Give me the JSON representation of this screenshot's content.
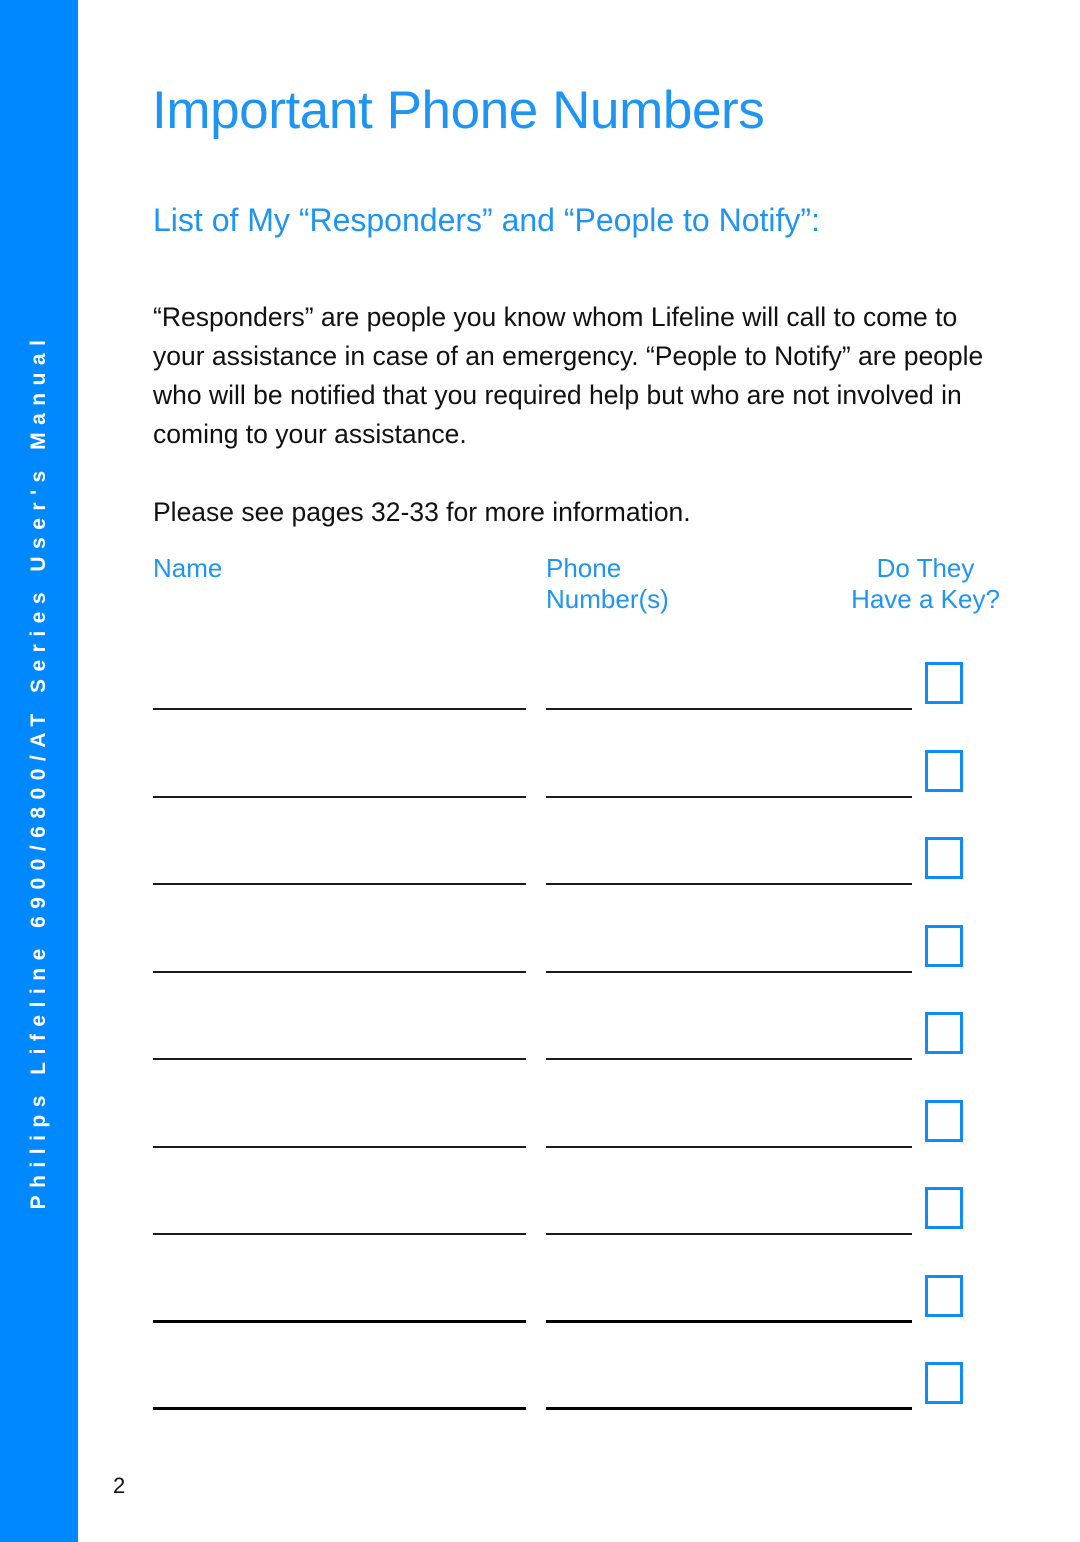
{
  "spine": {
    "text": "Philips Lifeline 6900/6800/AT Series User's Manual",
    "background_color": "#0089ff",
    "text_color": "#ffffff"
  },
  "document": {
    "title": "Important Phone Numbers",
    "section_heading": "List of My “Responders” and “People to Notify”:",
    "intro_paragraph": "“Responders” are people you know whom Lifeline will call to come to your assistance in case of an emergency. “People to Notify” are people who will be notified that you required help but who are not involved in coming to your assistance.",
    "reference_note": "Please see pages 32-33 for more information.",
    "page_number": "2",
    "accent_color": "#1e95f5",
    "rule_color": "#1c1c1c"
  },
  "table": {
    "headers": {
      "name": "Name",
      "phone_line1": "Phone",
      "phone_line2": "Number(s)",
      "key_line1": "Do They",
      "key_line2": "Have a Key?"
    },
    "row_count": 9,
    "rows": [
      {
        "name": "",
        "phone": "",
        "has_key": false,
        "emphasis": false
      },
      {
        "name": "",
        "phone": "",
        "has_key": false,
        "emphasis": false
      },
      {
        "name": "",
        "phone": "",
        "has_key": false,
        "emphasis": false
      },
      {
        "name": "",
        "phone": "",
        "has_key": false,
        "emphasis": false
      },
      {
        "name": "",
        "phone": "",
        "has_key": false,
        "emphasis": false
      },
      {
        "name": "",
        "phone": "",
        "has_key": false,
        "emphasis": false
      },
      {
        "name": "",
        "phone": "",
        "has_key": false,
        "emphasis": false
      },
      {
        "name": "",
        "phone": "",
        "has_key": false,
        "emphasis": true
      },
      {
        "name": "",
        "phone": "",
        "has_key": false,
        "emphasis": true
      }
    ]
  }
}
